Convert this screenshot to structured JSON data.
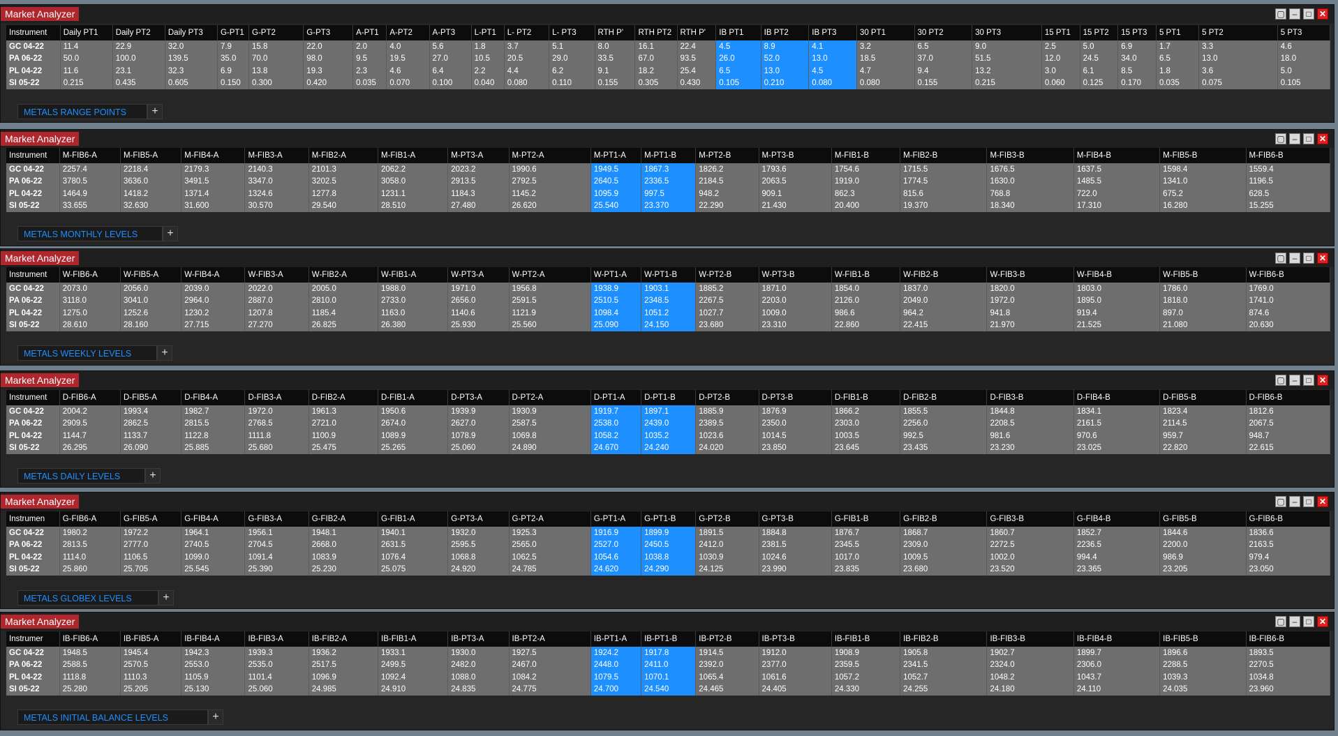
{
  "windows": [
    {
      "title": "Market Analyzer",
      "tab": "METALS RANGE POINTS",
      "columns": [
        "Instrument",
        "Daily PT1",
        "Daily PT2",
        "Daily PT3",
        "G-PT1",
        "G-PT2",
        "G-PT3",
        "A-PT1",
        "A-PT2",
        "A-PT3",
        "L-PT1",
        "L- PT2",
        "L- PT3",
        "RTH P'",
        "RTH PT2",
        "RTH P'",
        "IB PT1",
        "IB PT2",
        "IB PT3",
        "30 PT1",
        "30 PT2",
        "30 PT3",
        "15 PT1",
        "15 PT2",
        "15 PT3",
        "5 PT1",
        "5 PT2",
        "5 PT3"
      ],
      "highlight": [
        16,
        17,
        18
      ],
      "rows": [
        [
          "GC 04-22",
          "11.4",
          "22.9",
          "32.0",
          "7.9",
          "15.8",
          "22.0",
          "2.0",
          "4.0",
          "5.6",
          "1.8",
          "3.7",
          "5.1",
          "8.0",
          "16.1",
          "22.4",
          "4.5",
          "8.9",
          "4.1",
          "3.2",
          "6.5",
          "9.0",
          "2.5",
          "5.0",
          "6.9",
          "1.7",
          "3.3",
          "4.6"
        ],
        [
          "PA 06-22",
          "50.0",
          "100.0",
          "139.5",
          "35.0",
          "70.0",
          "98.0",
          "9.5",
          "19.5",
          "27.0",
          "10.5",
          "20.5",
          "29.0",
          "33.5",
          "67.0",
          "93.5",
          "26.0",
          "52.0",
          "13.0",
          "18.5",
          "37.0",
          "51.5",
          "12.0",
          "24.5",
          "34.0",
          "6.5",
          "13.0",
          "18.0"
        ],
        [
          "PL 04-22",
          "11.6",
          "23.1",
          "32.3",
          "6.9",
          "13.8",
          "19.3",
          "2.3",
          "4.6",
          "6.4",
          "2.2",
          "4.4",
          "6.2",
          "9.1",
          "18.2",
          "25.4",
          "6.5",
          "13.0",
          "4.5",
          "4.7",
          "9.4",
          "13.2",
          "3.0",
          "6.1",
          "8.5",
          "1.8",
          "3.6",
          "5.0"
        ],
        [
          "SI 05-22",
          "0.215",
          "0.435",
          "0.605",
          "0.150",
          "0.300",
          "0.420",
          "0.035",
          "0.070",
          "0.100",
          "0.040",
          "0.080",
          "0.110",
          "0.155",
          "0.305",
          "0.430",
          "0.105",
          "0.210",
          "0.080",
          "0.080",
          "0.155",
          "0.215",
          "0.060",
          "0.125",
          "0.170",
          "0.035",
          "0.075",
          "0.105"
        ]
      ]
    },
    {
      "title": "Market Analyzer",
      "tab": "METALS MONTHLY LEVELS",
      "columns": [
        "Instrument",
        "M-FIB6-A",
        "M-FIB5-A",
        "M-FIB4-A",
        "M-FIB3-A",
        "M-FIB2-A",
        "M-FIB1-A",
        "M-PT3-A",
        "M-PT2-A",
        "M-PT1-A",
        "M-PT1-B",
        "M-PT2-B",
        "M-PT3-B",
        "M-FIB1-B",
        "M-FIB2-B",
        "M-FIB3-B",
        "M-FIB4-B",
        "M-FIB5-B",
        "M-FIB6-B"
      ],
      "highlight": [
        9,
        10
      ],
      "rows": [
        [
          "GC 04-22",
          "2257.4",
          "2218.4",
          "2179.3",
          "2140.3",
          "2101.3",
          "2062.2",
          "2023.2",
          "1990.6",
          "1949.5",
          "1867.3",
          "1826.2",
          "1793.6",
          "1754.6",
          "1715.5",
          "1676.5",
          "1637.5",
          "1598.4",
          "1559.4"
        ],
        [
          "PA 06-22",
          "3780.5",
          "3636.0",
          "3491.5",
          "3347.0",
          "3202.5",
          "3058.0",
          "2913.5",
          "2792.5",
          "2640.5",
          "2336.5",
          "2184.5",
          "2063.5",
          "1919.0",
          "1774.5",
          "1630.0",
          "1485.5",
          "1341.0",
          "1196.5"
        ],
        [
          "PL 04-22",
          "1464.9",
          "1418.2",
          "1371.4",
          "1324.6",
          "1277.8",
          "1231.1",
          "1184.3",
          "1145.2",
          "1095.9",
          "997.5",
          "948.2",
          "909.1",
          "862.3",
          "815.6",
          "768.8",
          "722.0",
          "675.2",
          "628.5"
        ],
        [
          "SI 05-22",
          "33.655",
          "32.630",
          "31.600",
          "30.570",
          "29.540",
          "28.510",
          "27.480",
          "26.620",
          "25.540",
          "23.370",
          "22.290",
          "21.430",
          "20.400",
          "19.370",
          "18.340",
          "17.310",
          "16.280",
          "15.255"
        ]
      ]
    },
    {
      "title": "Market Analyzer",
      "tab": "METALS WEEKLY LEVELS",
      "columns": [
        "Instrument",
        "W-FIB6-A",
        "W-FIB5-A",
        "W-FIB4-A",
        "W-FIB3-A",
        "W-FIB2-A",
        "W-FIB1-A",
        "W-PT3-A",
        "W-PT2-A",
        "W-PT1-A",
        "W-PT1-B",
        "W-PT2-B",
        "W-PT3-B",
        "W-FIB1-B",
        "W-FIB2-B",
        "W-FIB3-B",
        "W-FIB4-B",
        "W-FIB5-B",
        "W-FIB6-B"
      ],
      "highlight": [
        9,
        10
      ],
      "rows": [
        [
          "GC 04-22",
          "2073.0",
          "2056.0",
          "2039.0",
          "2022.0",
          "2005.0",
          "1988.0",
          "1971.0",
          "1956.8",
          "1938.9",
          "1903.1",
          "1885.2",
          "1871.0",
          "1854.0",
          "1837.0",
          "1820.0",
          "1803.0",
          "1786.0",
          "1769.0"
        ],
        [
          "PA 06-22",
          "3118.0",
          "3041.0",
          "2964.0",
          "2887.0",
          "2810.0",
          "2733.0",
          "2656.0",
          "2591.5",
          "2510.5",
          "2348.5",
          "2267.5",
          "2203.0",
          "2126.0",
          "2049.0",
          "1972.0",
          "1895.0",
          "1818.0",
          "1741.0"
        ],
        [
          "PL 04-22",
          "1275.0",
          "1252.6",
          "1230.2",
          "1207.8",
          "1185.4",
          "1163.0",
          "1140.6",
          "1121.9",
          "1098.4",
          "1051.2",
          "1027.7",
          "1009.0",
          "986.6",
          "964.2",
          "941.8",
          "919.4",
          "897.0",
          "874.6"
        ],
        [
          "SI 05-22",
          "28.610",
          "28.160",
          "27.715",
          "27.270",
          "26.825",
          "26.380",
          "25.930",
          "25.560",
          "25.090",
          "24.150",
          "23.680",
          "23.310",
          "22.860",
          "22.415",
          "21.970",
          "21.525",
          "21.080",
          "20.630"
        ]
      ]
    },
    {
      "title": "Market Analyzer",
      "tab": "METALS DAILY LEVELS",
      "columns": [
        "Instrument",
        "D-FIB6-A",
        "D-FIB5-A",
        "D-FIB4-A",
        "D-FIB3-A",
        "D-FIB2-A",
        "D-FIB1-A",
        "D-PT3-A",
        "D-PT2-A",
        "D-PT1-A",
        "D-PT1-B",
        "D-PT2-B",
        "D-PT3-B",
        "D-FIB1-B",
        "D-FIB2-B",
        "D-FIB3-B",
        "D-FIB4-B",
        "D-FIB5-B",
        "D-FIB6-B"
      ],
      "highlight": [
        9,
        10
      ],
      "rows": [
        [
          "GC 04-22",
          "2004.2",
          "1993.4",
          "1982.7",
          "1972.0",
          "1961.3",
          "1950.6",
          "1939.9",
          "1930.9",
          "1919.7",
          "1897.1",
          "1885.9",
          "1876.9",
          "1866.2",
          "1855.5",
          "1844.8",
          "1834.1",
          "1823.4",
          "1812.6"
        ],
        [
          "PA 06-22",
          "2909.5",
          "2862.5",
          "2815.5",
          "2768.5",
          "2721.0",
          "2674.0",
          "2627.0",
          "2587.5",
          "2538.0",
          "2439.0",
          "2389.5",
          "2350.0",
          "2303.0",
          "2256.0",
          "2208.5",
          "2161.5",
          "2114.5",
          "2067.5"
        ],
        [
          "PL 04-22",
          "1144.7",
          "1133.7",
          "1122.8",
          "1111.8",
          "1100.9",
          "1089.9",
          "1078.9",
          "1069.8",
          "1058.2",
          "1035.2",
          "1023.6",
          "1014.5",
          "1003.5",
          "992.5",
          "981.6",
          "970.6",
          "959.7",
          "948.7"
        ],
        [
          "SI 05-22",
          "26.295",
          "26.090",
          "25.885",
          "25.680",
          "25.475",
          "25.265",
          "25.060",
          "24.890",
          "24.670",
          "24.240",
          "24.020",
          "23.850",
          "23.645",
          "23.435",
          "23.230",
          "23.025",
          "22.820",
          "22.615"
        ]
      ]
    },
    {
      "title": "Market Analyzer",
      "tab": "METALS GLOBEX LEVELS",
      "columns": [
        "Instrumen",
        "G-FIB6-A",
        "G-FIB5-A",
        "G-FIB4-A",
        "G-FIB3-A",
        "G-FIB2-A",
        "G-FIB1-A",
        "G-PT3-A",
        "G-PT2-A",
        "G-PT1-A",
        "G-PT1-B",
        "G-PT2-B",
        "G-PT3-B",
        "G-FIB1-B",
        "G-FIB2-B",
        "G-FIB3-B",
        "G-FIB4-B",
        "G-FIB5-B",
        "G-FIB6-B"
      ],
      "highlight": [
        9,
        10
      ],
      "rows": [
        [
          "GC 04-22",
          "1980.2",
          "1972.2",
          "1964.1",
          "1956.1",
          "1948.1",
          "1940.1",
          "1932.0",
          "1925.3",
          "1916.9",
          "1899.9",
          "1891.5",
          "1884.8",
          "1876.7",
          "1868.7",
          "1860.7",
          "1852.7",
          "1844.6",
          "1836.6"
        ],
        [
          "PA 06-22",
          "2813.5",
          "2777.0",
          "2740.5",
          "2704.5",
          "2668.0",
          "2631.5",
          "2595.5",
          "2565.0",
          "2527.0",
          "2450.5",
          "2412.0",
          "2381.5",
          "2345.5",
          "2309.0",
          "2272.5",
          "2236.5",
          "2200.0",
          "2163.5"
        ],
        [
          "PL 04-22",
          "1114.0",
          "1106.5",
          "1099.0",
          "1091.4",
          "1083.9",
          "1076.4",
          "1068.8",
          "1062.5",
          "1054.6",
          "1038.8",
          "1030.9",
          "1024.6",
          "1017.0",
          "1009.5",
          "1002.0",
          "994.4",
          "986.9",
          "979.4"
        ],
        [
          "SI 05-22",
          "25.860",
          "25.705",
          "25.545",
          "25.390",
          "25.230",
          "25.075",
          "24.920",
          "24.785",
          "24.620",
          "24.290",
          "24.125",
          "23.990",
          "23.835",
          "23.680",
          "23.520",
          "23.365",
          "23.205",
          "23.050"
        ]
      ]
    },
    {
      "title": "Market Analyzer",
      "tab": "METALS  INITIAL BALANCE LEVELS",
      "columns": [
        "Instrumer",
        "IB-FIB6-A",
        "IB-FIB5-A",
        "IB-FIB4-A",
        "IB-FIB3-A",
        "IB-FIB2-A",
        "IB-FIB1-A",
        "IB-PT3-A",
        "IB-PT2-A",
        "IB-PT1-A",
        "IB-PT1-B",
        "IB-PT2-B",
        "IB-PT3-B",
        "IB-FIB1-B",
        "IB-FIB2-B",
        "IB-FIB3-B",
        "IB-FIB4-B",
        "IB-FIB5-B",
        "IB-FIB6-B"
      ],
      "highlight": [
        9,
        10
      ],
      "rows": [
        [
          "GC 04-22",
          "1948.5",
          "1945.4",
          "1942.3",
          "1939.3",
          "1936.2",
          "1933.1",
          "1930.0",
          "1927.5",
          "1924.2",
          "1917.8",
          "1914.5",
          "1912.0",
          "1908.9",
          "1905.8",
          "1902.7",
          "1899.7",
          "1896.6",
          "1893.5"
        ],
        [
          "PA 06-22",
          "2588.5",
          "2570.5",
          "2553.0",
          "2535.0",
          "2517.5",
          "2499.5",
          "2482.0",
          "2467.0",
          "2448.0",
          "2411.0",
          "2392.0",
          "2377.0",
          "2359.5",
          "2341.5",
          "2324.0",
          "2306.0",
          "2288.5",
          "2270.5"
        ],
        [
          "PL 04-22",
          "1118.8",
          "1110.3",
          "1105.9",
          "1101.4",
          "1096.9",
          "1092.4",
          "1088.0",
          "1084.2",
          "1079.5",
          "1070.1",
          "1065.4",
          "1061.6",
          "1057.2",
          "1052.7",
          "1048.2",
          "1043.7",
          "1039.3",
          "1034.8"
        ],
        [
          "SI 05-22",
          "25.280",
          "25.205",
          "25.130",
          "25.060",
          "24.985",
          "24.910",
          "24.835",
          "24.775",
          "24.700",
          "24.540",
          "24.465",
          "24.405",
          "24.330",
          "24.255",
          "24.180",
          "24.110",
          "24.035",
          "23.960"
        ]
      ]
    }
  ],
  "add_tab_label": "+",
  "window_buttons": {
    "restore": "▢",
    "minimize": "–",
    "maximize": "□",
    "close": "✕"
  }
}
